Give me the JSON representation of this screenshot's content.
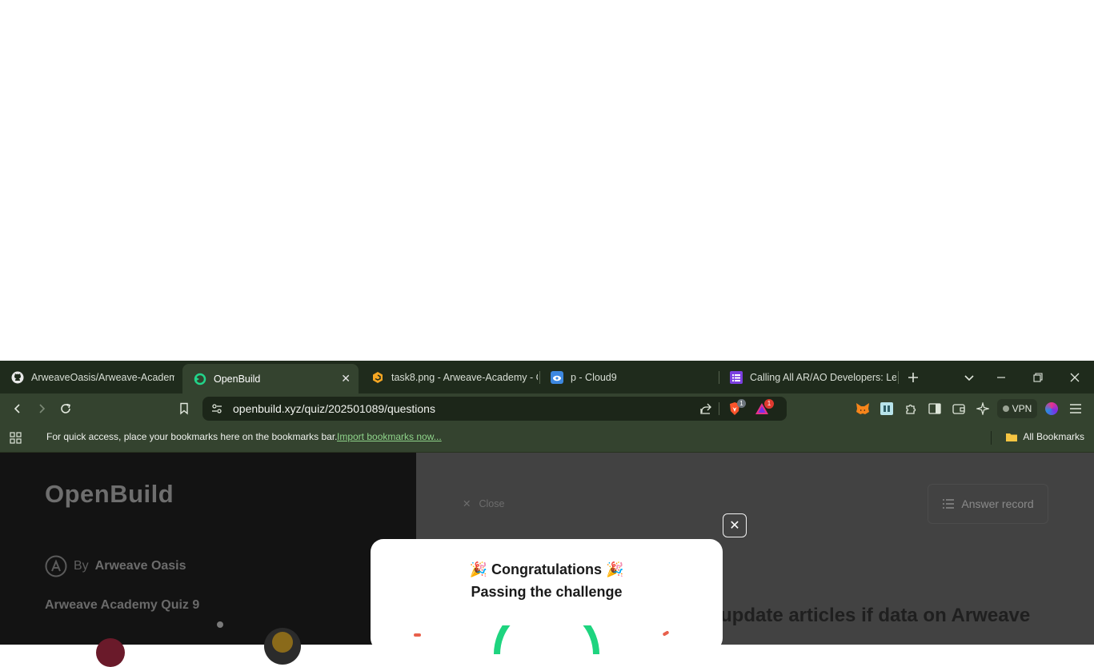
{
  "tabs": [
    {
      "title": "ArweaveOasis/Arweave-Academy",
      "icon": "github-icon",
      "active": false
    },
    {
      "title": "OpenBuild",
      "icon": "openbuild-icon",
      "active": true
    },
    {
      "title": "task8.png - Arweave-Academy - G",
      "icon": "gitbook-icon",
      "active": false
    },
    {
      "title": "p - Cloud9",
      "icon": "cloud9-icon",
      "active": false
    },
    {
      "title": "Calling All AR/AO Developers: Let",
      "icon": "form-icon",
      "active": false
    }
  ],
  "address_bar": {
    "url": "openbuild.xyz/quiz/202501089/questions"
  },
  "badges": {
    "brave_count": "1",
    "rewards_count": "1"
  },
  "toolbar": {
    "vpn_label": "VPN"
  },
  "bookmarks_bar": {
    "message": "For quick access, place your bookmarks here on the bookmarks bar.",
    "import_link": "Import bookmarks now...",
    "all_bookmarks": "All Bookmarks"
  },
  "page": {
    "logo_text": "OpenBuild",
    "by_prefix": "By",
    "by_author": "Arweave Oasis",
    "quiz_title": "Arweave Academy Quiz 9",
    "close_label": "Close",
    "answer_record_label": "Answer record",
    "question_fragment": "update articles if data on Arweave"
  },
  "modal": {
    "title": "Congratulations",
    "subtitle": "Passing the challenge",
    "emoji": "🎉"
  },
  "colors": {
    "chrome_dark": "#1f2b1c",
    "chrome": "#34432f",
    "accent_green": "#1ed47f"
  }
}
